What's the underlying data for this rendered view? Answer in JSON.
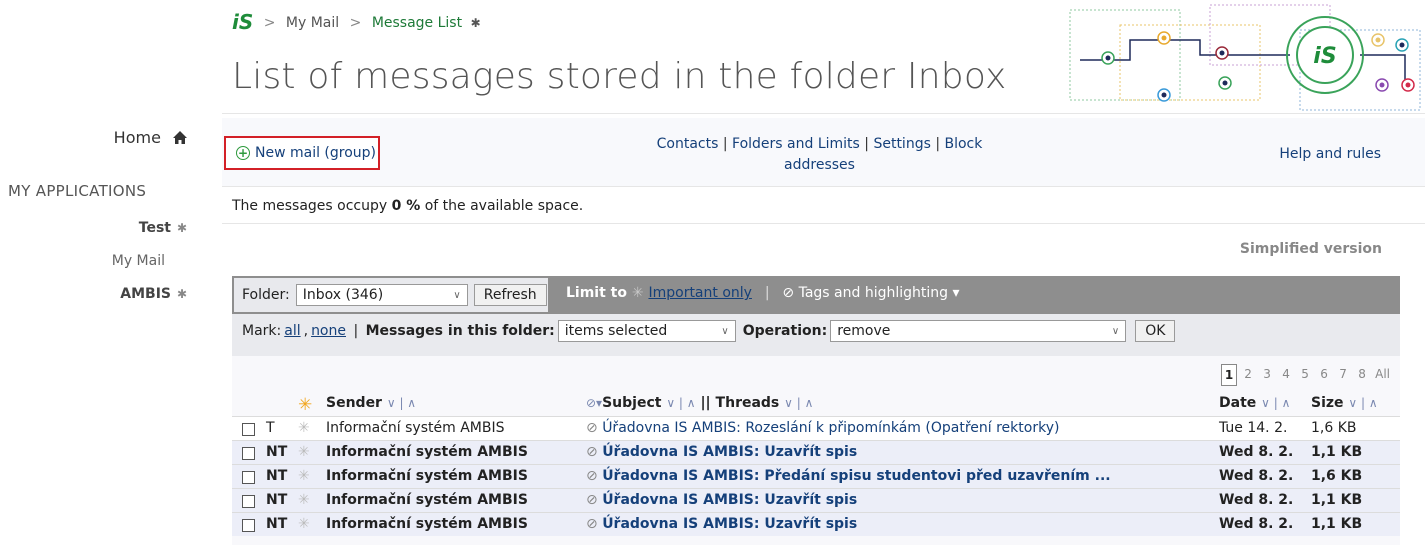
{
  "colors": {
    "accent": "#1e8c3a",
    "link": "#15407a",
    "highlight": "#d32027"
  },
  "breadcrumb": {
    "logo": "iS",
    "items": [
      "My Mail",
      "Message List"
    ]
  },
  "page_title": "List of messages stored in the folder Inbox",
  "sidebar": {
    "home": "Home",
    "apps_heading": "MY APPLICATIONS",
    "items": [
      {
        "label": "Test"
      },
      {
        "label": "My Mail"
      },
      {
        "label": "AMBIS"
      }
    ]
  },
  "actions": {
    "new_mail": "New mail (group)",
    "links": [
      "Contacts",
      "Folders and Limits",
      "Settings",
      "Block addresses"
    ],
    "help": "Help and rules"
  },
  "storage": {
    "before": "The messages occupy ",
    "value": "0 %",
    "after": " of the available space."
  },
  "simplified_version": "Simplified version",
  "folder_bar": {
    "folder_label": "Folder:",
    "folder_value": "Inbox (346)",
    "refresh": "Refresh",
    "limit_to": "Limit to",
    "important_only": "Important only",
    "tags": "Tags and highlighting"
  },
  "mark_bar": {
    "mark_label": "Mark:",
    "all": "all",
    "none": "none",
    "in_folder_label": "Messages in this folder:",
    "in_folder_value": "items selected",
    "operation_label": "Operation:",
    "operation_value": "remove",
    "ok": "OK"
  },
  "pager": [
    "1",
    "2",
    "3",
    "4",
    "5",
    "6",
    "7",
    "8",
    "All"
  ],
  "columns": {
    "sender": "Sender",
    "subject": "Subject",
    "threads": "Threads",
    "date": "Date",
    "size": "Size",
    "sort": "∨ | ∧"
  },
  "messages": [
    {
      "flag": "T",
      "sender": "Informační systém AMBIS",
      "subject": "Úřadovna IS AMBIS: Rozeslání k připomínkám (Opatření rektorky)",
      "date": "Tue 14. 2.",
      "size": "1,6 KB",
      "unread": false
    },
    {
      "flag": "NT",
      "sender": "Informační systém AMBIS",
      "subject": "Úřadovna IS AMBIS: Uzavřít spis",
      "date": "Wed 8. 2.",
      "size": "1,1 KB",
      "unread": true
    },
    {
      "flag": "NT",
      "sender": "Informační systém AMBIS",
      "subject": "Úřadovna IS AMBIS: Předání spisu studentovi před uzavřením ...",
      "date": "Wed 8. 2.",
      "size": "1,6 KB",
      "unread": true
    },
    {
      "flag": "NT",
      "sender": "Informační systém AMBIS",
      "subject": "Úřadovna IS AMBIS: Uzavřít spis",
      "date": "Wed 8. 2.",
      "size": "1,1 KB",
      "unread": true
    },
    {
      "flag": "NT",
      "sender": "Informační systém AMBIS",
      "subject": "Úřadovna IS AMBIS: Uzavřít spis",
      "date": "Wed 8. 2.",
      "size": "1,1 KB",
      "unread": true
    }
  ]
}
